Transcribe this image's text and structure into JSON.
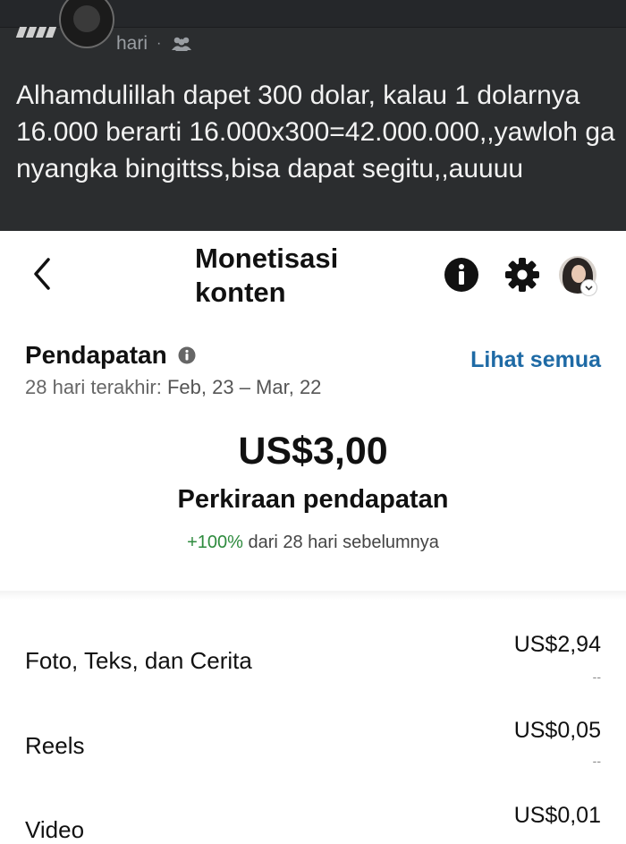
{
  "post": {
    "meta_text": "hari",
    "meta_separator": "·",
    "body": "Alhamdulillah dapet 300 dolar, kalau 1 dolarnya 16.000 berarti 16.000x300=42.000.000,,yawloh ga nyangka bingittss,bisa dapat segitu,,auuuu"
  },
  "header": {
    "title": "Monetisasi konten"
  },
  "earnings": {
    "title": "Pendapatan",
    "see_all": "Lihat semua",
    "range_label": "28 hari terakhir:",
    "range_value": "Feb, 23 – Mar, 22",
    "amount": "US$3,00",
    "estimate_label": "Perkiraan pendapatan",
    "change_percent": "+100%",
    "change_text": "dari 28 hari sebelumnya"
  },
  "breakdown": [
    {
      "label": "Foto, Teks, dan Cerita",
      "value": "US$2,94",
      "sub": "--"
    },
    {
      "label": "Reels",
      "value": "US$0,05",
      "sub": "--"
    },
    {
      "label": "Video",
      "value": "US$0,01",
      "sub": ""
    }
  ],
  "colors": {
    "post_bg": "#2b2d2f",
    "link": "#1e6aa5",
    "positive": "#2e8b3e"
  }
}
